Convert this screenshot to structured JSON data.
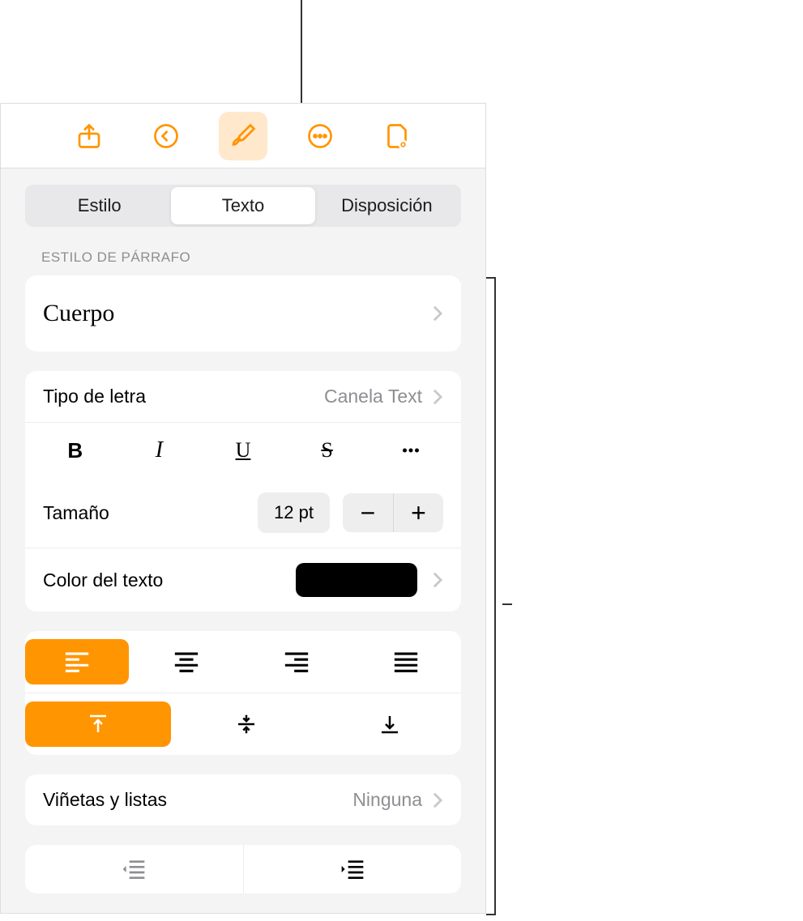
{
  "toolbar": {
    "share": "share",
    "undo": "undo",
    "format": "format",
    "more": "more",
    "document": "document"
  },
  "tabs": {
    "style": "Estilo",
    "text": "Texto",
    "layout": "Disposición"
  },
  "sections": {
    "paragraph_style_header": "ESTILO DE PÁRRAFO",
    "paragraph_style_value": "Cuerpo",
    "font_label": "Tipo de letra",
    "font_value": "Canela Text",
    "size_label": "Tamaño",
    "size_value": "12 pt",
    "text_color_label": "Color del texto",
    "text_color_value": "#000000",
    "bullets_label": "Viñetas y listas",
    "bullets_value": "Ninguna"
  },
  "format_buttons": {
    "bold": "B",
    "italic": "I",
    "underline": "U",
    "strike": "S",
    "more": "more"
  },
  "stepper": {
    "minus": "−",
    "plus": "+"
  }
}
